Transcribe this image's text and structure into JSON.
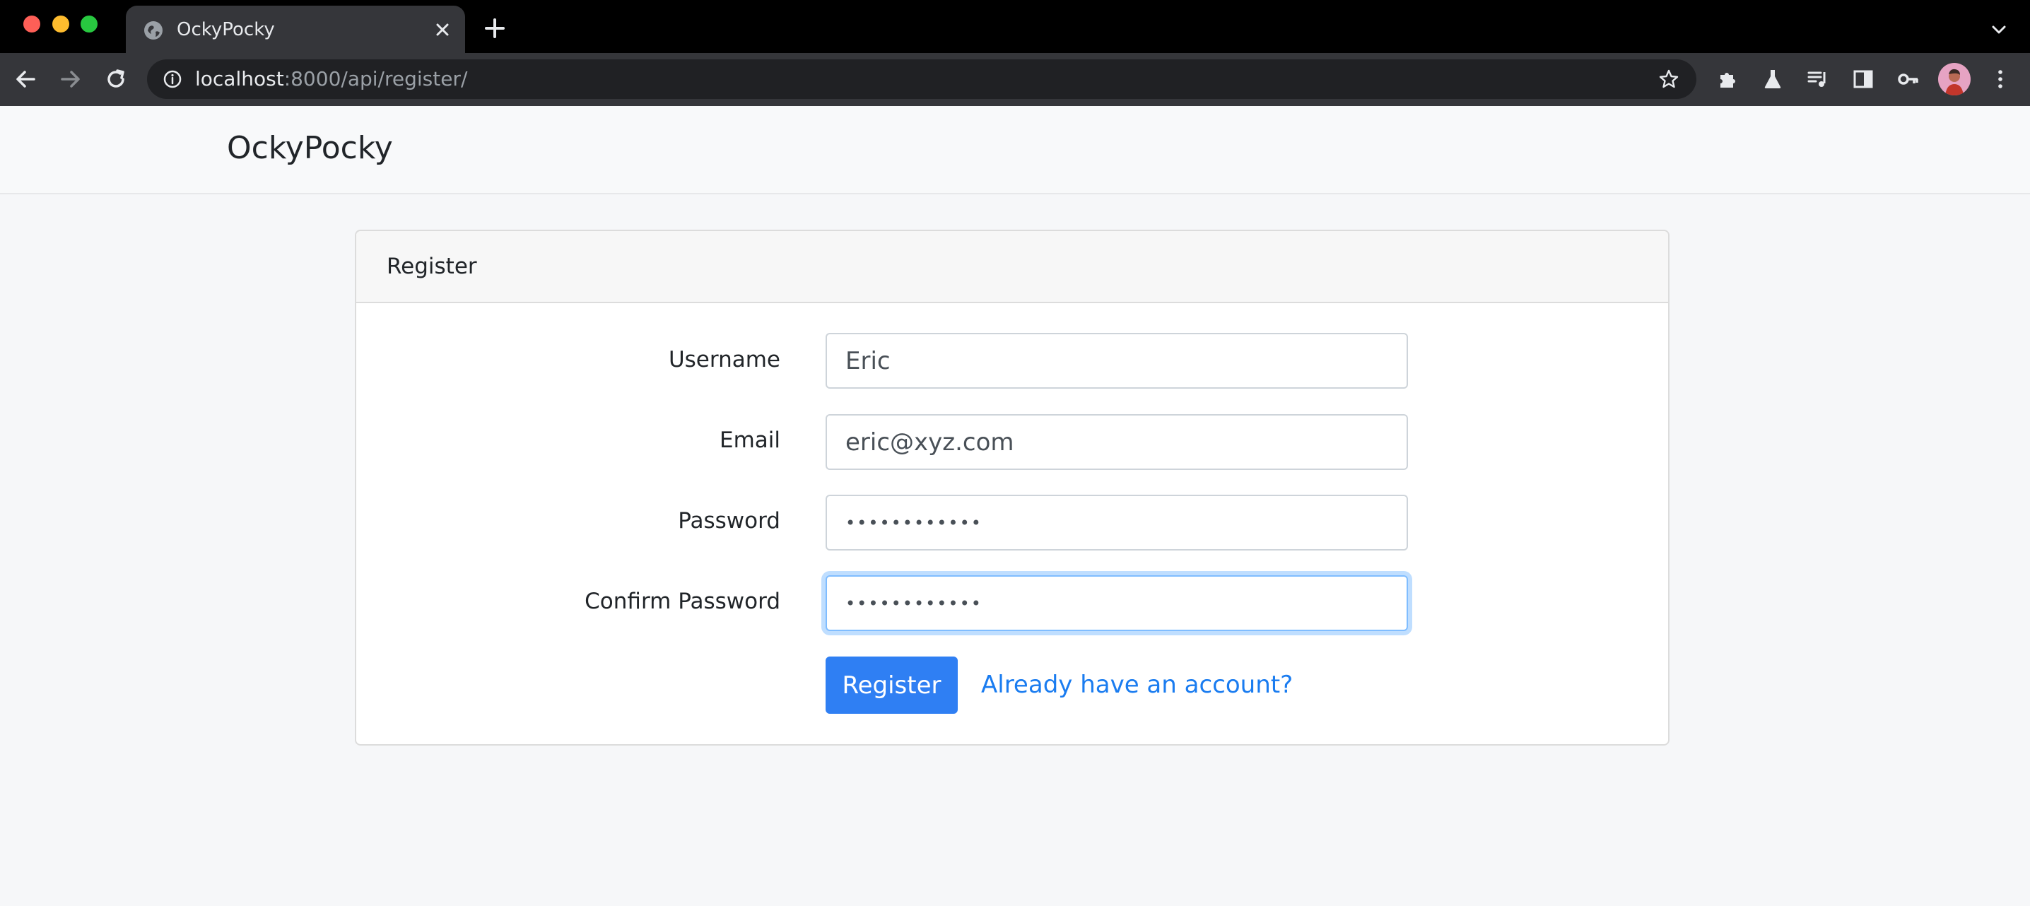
{
  "browser": {
    "tab_title": "OckyPocky",
    "url_host": "localhost",
    "url_rest": ":8000/api/register/"
  },
  "navbar": {
    "brand": "OckyPocky"
  },
  "card": {
    "header": "Register",
    "fields": {
      "username": {
        "label": "Username",
        "value": "Eric"
      },
      "email": {
        "label": "Email",
        "value": "eric@xyz.com"
      },
      "password": {
        "label": "Password",
        "value": "••••••••••••"
      },
      "confirm_password": {
        "label": "Confirm Password",
        "value": "••••••••••••"
      }
    },
    "submit_label": "Register",
    "login_link": "Already have an account?"
  },
  "colors": {
    "primary": "#2f7ff3",
    "link": "#1a7cf0",
    "focus_ring": "#80bdff"
  },
  "icons": [
    "globe-icon",
    "close-icon",
    "plus-icon",
    "chevron-down-icon",
    "back-arrow-icon",
    "forward-arrow-icon",
    "reload-icon",
    "info-icon",
    "star-icon",
    "puzzle-icon",
    "flask-icon",
    "media-queue-icon",
    "side-panel-icon",
    "key-icon",
    "kebab-menu-icon"
  ]
}
